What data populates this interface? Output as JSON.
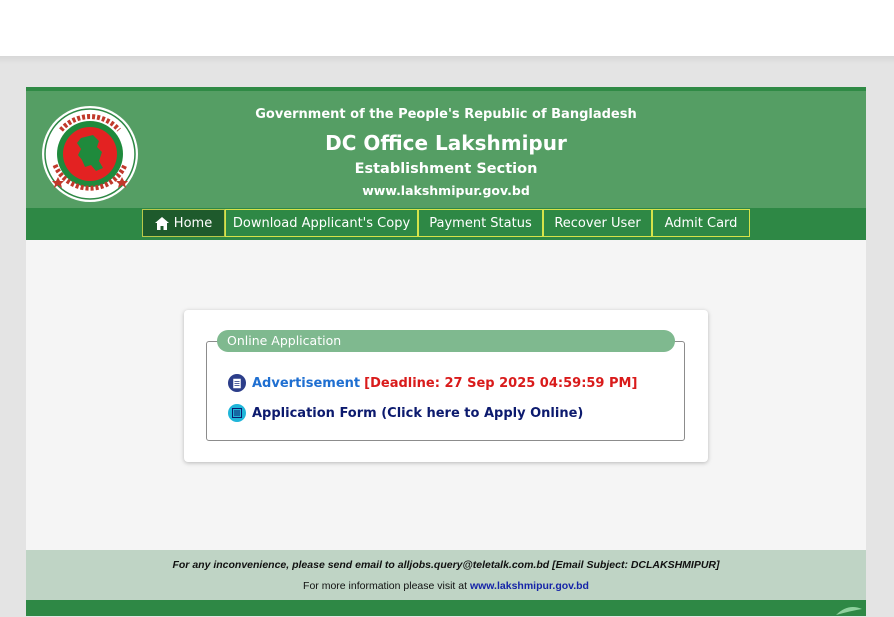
{
  "header": {
    "government": "Government of the People's Republic of Bangladesh",
    "office": "DC Office Lakshmipur",
    "section": "Establishment Section",
    "website": "www.lakshmipur.gov.bd",
    "logo_icon": "bangladesh-government-seal"
  },
  "nav": {
    "items": [
      {
        "label": "Home",
        "icon": "home-icon",
        "active": true
      },
      {
        "label": "Download Applicant's Copy"
      },
      {
        "label": "Payment Status"
      },
      {
        "label": "Recover User"
      },
      {
        "label": "Admit Card"
      }
    ]
  },
  "panel": {
    "legend": "Online Application",
    "advertisement_label": "Advertisement",
    "deadline": "[Deadline: 27 Sep 2025 04:59:59 PM]",
    "application_form_label": "Application Form (Click here to Apply Online)"
  },
  "footer": {
    "contact_text": "For any inconvenience, please send email to alljobs.query@teletalk.com.bd [Email Subject: DCLAKSHMIPUR]",
    "more_info_prefix": "For more information please visit at",
    "more_info_link": "www.lakshmipur.gov.bd"
  },
  "colors": {
    "header_green": "#559e64",
    "nav_green": "#2e8845",
    "link_blue": "#1f6fd1",
    "deadline_red": "#d91b1b"
  }
}
